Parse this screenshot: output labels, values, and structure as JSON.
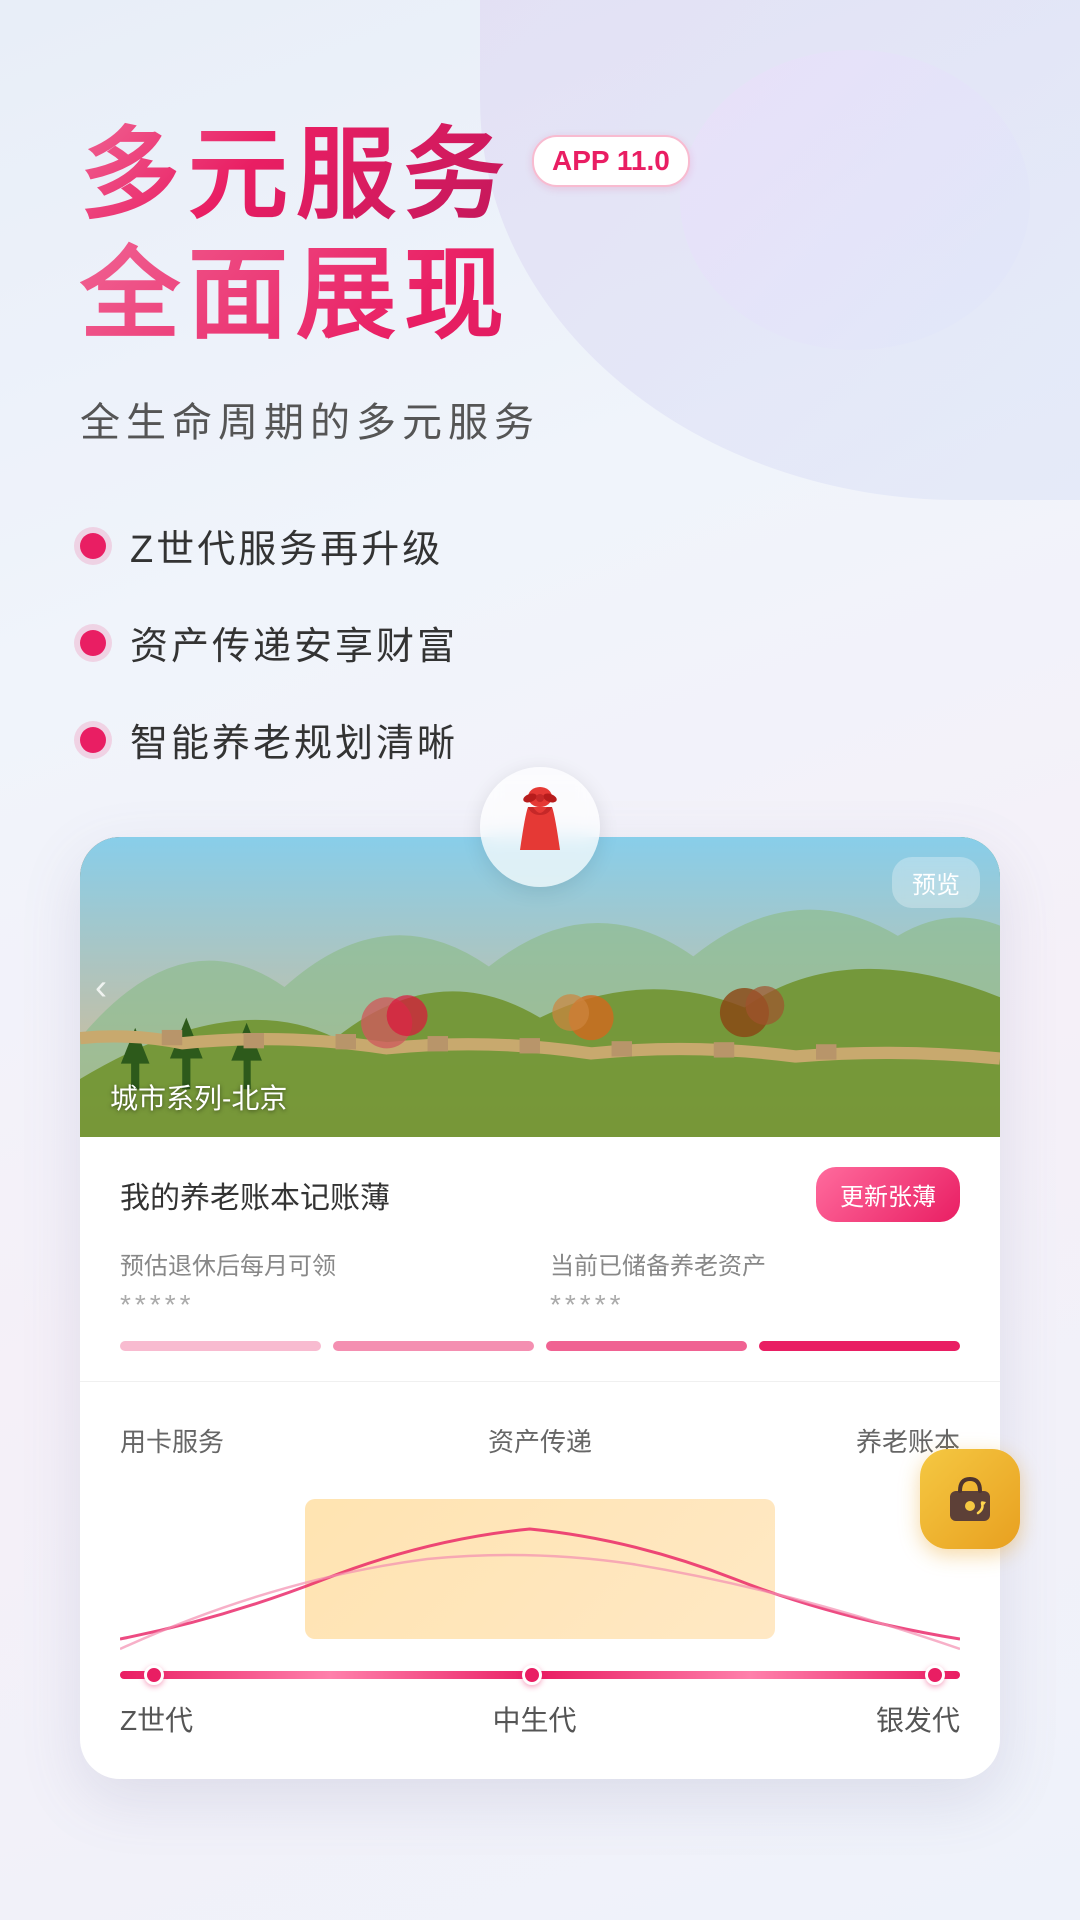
{
  "header": {
    "title_line1": "多元服务",
    "title_line2": "全面展现",
    "app_version": "APP 11.0",
    "subtitle": "全生命周期的多元服务"
  },
  "features": [
    {
      "id": 1,
      "text": "Z世代服务再升级"
    },
    {
      "id": 2,
      "text": "资产传递安享财富"
    },
    {
      "id": 3,
      "text": "智能养老规划清晰"
    }
  ],
  "card": {
    "banner": {
      "label": "城市系列-北京",
      "preview_btn": "预览",
      "nav_left": "‹"
    },
    "account": {
      "title": "我的养老账本记账薄",
      "update_btn": "更新张薄",
      "stat1_label": "预估退休后每月可领",
      "stat1_value": "*****",
      "stat2_label": "当前已储备养老资产",
      "stat2_value": "*****"
    },
    "lifecycle": {
      "label_left": "用卡服务",
      "label_center": "资产传递",
      "label_right": "养老账本",
      "axis_labels": [
        "Z世代",
        "中生代",
        "银发代"
      ]
    }
  },
  "colors": {
    "primary": "#e91e63",
    "primary_light": "#f06292",
    "accent_gold": "#f5c842",
    "bar1": "#f8bbd0",
    "bar2": "#f48fb1",
    "bar3": "#f06292",
    "bar4": "#e91e63"
  }
}
